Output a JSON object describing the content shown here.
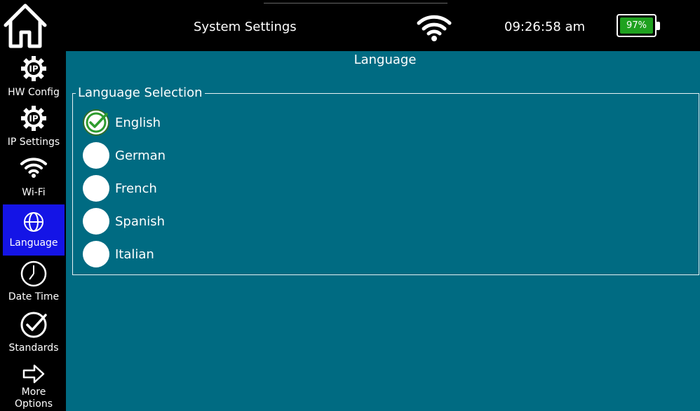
{
  "header": {
    "title": "System Settings",
    "time": "09:26:58 am",
    "battery": "97%",
    "battery_level": 0.97
  },
  "sidebar": {
    "items": [
      {
        "label": "HW Config",
        "icon": "ip-gear-icon"
      },
      {
        "label": "IP Settings",
        "icon": "ip-gear-icon"
      },
      {
        "label": "Wi-Fi",
        "icon": "wifi-icon"
      },
      {
        "label": "Language",
        "icon": "globe-icon",
        "active": true
      },
      {
        "label": "Date Time",
        "icon": "clock-icon"
      },
      {
        "label": "Standards",
        "icon": "check-circle-icon"
      },
      {
        "label": "More Options",
        "icon": "arrow-right-icon",
        "lines": [
          "More",
          "Options"
        ]
      }
    ]
  },
  "main": {
    "title": "Language",
    "group_title": "Language Selection",
    "options": [
      {
        "label": "English",
        "selected": true
      },
      {
        "label": "German",
        "selected": false
      },
      {
        "label": "French",
        "selected": false
      },
      {
        "label": "Spanish",
        "selected": false
      },
      {
        "label": "Italian",
        "selected": false
      }
    ]
  },
  "colors": {
    "main_bg": "#006b82",
    "active_item": "#1414e6",
    "battery": "#1fa11f",
    "check": "#2e9b2e"
  }
}
